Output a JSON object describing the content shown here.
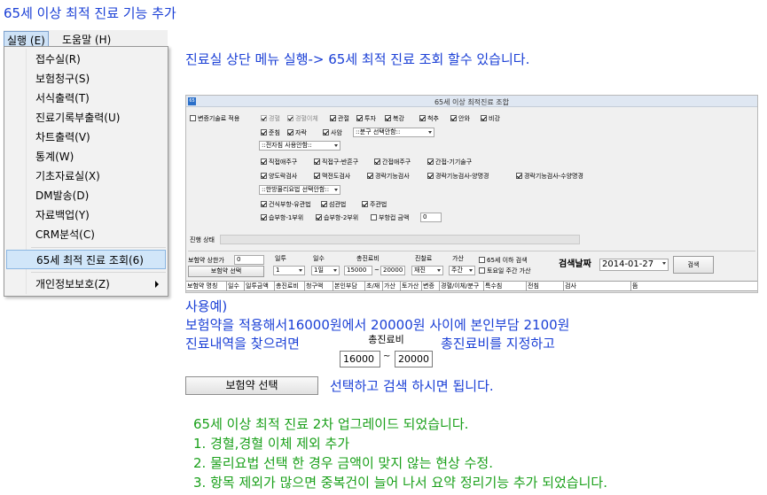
{
  "page_title": "65세 이상 최적 진료 기능 추가",
  "menubar": {
    "run": "실행 (E)",
    "help": "도움말 (H)"
  },
  "dropdown": {
    "items": [
      {
        "label": "접수실(R)"
      },
      {
        "label": "보험청구(S)"
      },
      {
        "label": "서식출력(T)"
      },
      {
        "label": "진료기록부출력(U)"
      },
      {
        "label": "차트출력(V)"
      },
      {
        "label": "통계(W)"
      },
      {
        "label": "기초자료실(X)"
      },
      {
        "label": "DM발송(D)"
      },
      {
        "label": "자료백업(Y)"
      },
      {
        "label": "CRM분석(C)"
      }
    ],
    "selected": "65세 최적 진료 조회(6)",
    "privacy": "개인정보보호(Z)"
  },
  "instruction": "진료실 상단 메뉴 실행-> 65세 최적 진료 조회 할수 있습니다.",
  "app": {
    "icon": "65",
    "title": "65세 이상  최적진료 조합",
    "row1": {
      "exclude": "변증기술료 적용",
      "items": [
        "경혈",
        "경혈이체",
        "관절",
        "투자",
        "복강",
        "척추",
        "안와",
        "비강"
      ]
    },
    "row2": {
      "items": [
        "준침",
        "자락",
        "사암"
      ],
      "combo": "::분구 선택안함::"
    },
    "row3_combo": "::전자침 사용안함::",
    "row4": [
      "직접애주구",
      "직접구-반흔구",
      "간접애주구",
      "간접-기기술구"
    ],
    "row5": [
      "양도락검사",
      "맥전도검사",
      "경락기능검사",
      "경락기능검사-양명경",
      "경락기능검사-수양명경"
    ],
    "row6_combo": "::한방물리요법 선택안함::",
    "row7": [
      "건식부항-유관법",
      "섬관법",
      "주관법"
    ],
    "row8": {
      "items": [
        "습부항-1부위",
        "습부항-2부위",
        "부항컵 금액"
      ],
      "value": "0"
    },
    "progress_label": "진행 상태",
    "filter": {
      "insurance_copay_label": "보험약 상한가",
      "insurance_copay_value": "0",
      "insurance_button": "보험약 선택",
      "days_label": "일투",
      "days_value": "1",
      "count_label": "일수",
      "count_value": "1일",
      "total_label": "총진료비",
      "total_from": "15000",
      "tilde": "~",
      "total_to": "20000",
      "fee_label": "진찰료",
      "fee_value": "재진",
      "extra_label": "가산",
      "extra_value": "주간",
      "under65": "65세 이하 검색",
      "saturday": "토요일 주간 가산",
      "date_label": "검색날짜",
      "date_value": "2014-01-27",
      "search_button": "검색"
    },
    "grid_columns": [
      "보험약 명칭",
      "일수",
      "일투금액",
      "총진료비",
      "청구액",
      "본인부담",
      "초/재",
      "가산",
      "토가산",
      "변증",
      "경혈/이체/분구",
      "특수침",
      "전침",
      "검사",
      "뜸"
    ]
  },
  "example": {
    "heading": "사용예)",
    "line1": "보험약을 적용해서16000원에서 20000원 사이에 본인부담 2100원",
    "line2_a": "진료내역을 찾으려면",
    "line2_b": "총진료비를 지정하고",
    "label": "총진료비",
    "from": "16000",
    "tilde": "~",
    "to": "20000",
    "button": "보험약 선택",
    "button_suffix": "선택하고 검색 하시면 됩니다."
  },
  "upgrade": {
    "title": "65세 이상 최적 진료 2차 업그레이드 되었습니다.",
    "items": [
      "1. 경혈,경혈 이체  제외 추가",
      "2. 물리요법 선택 한 경우 금액이 맞지 않는 현상 수정.",
      "3. 항목 제외가 많으면 중복건이 늘어 나서 요약 정리기능 추가 되었습니다."
    ]
  },
  "colors": {
    "text_blue": "#1a3fd6",
    "text_green": "#1aa01a",
    "menu_highlight": "#d1e6f9"
  }
}
